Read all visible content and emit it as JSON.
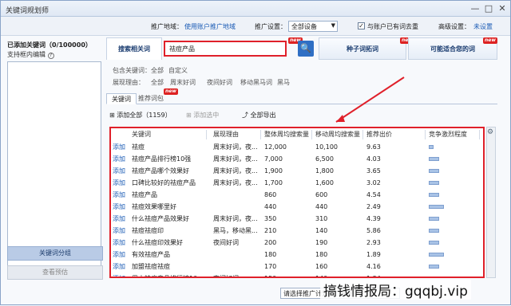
{
  "window": {
    "title": "关键词规划师",
    "min": "—",
    "max": "□",
    "close": "✕"
  },
  "topbar": {
    "area_label": "推广地域：",
    "area_value": "使用账户推广地域",
    "device_label": "推广设置：",
    "device_value": "全部设备",
    "dedupe_label": "与账户已有词去重",
    "dedupe_checked": true,
    "advanced_label": "高级设置：",
    "advanced_value": "未设置"
  },
  "left": {
    "added_title": "已添加关键词（0/100000）",
    "hint": "支持框内编辑",
    "help_icon": "?",
    "group_btn": "关键词分组",
    "preview_btn": "查看预估"
  },
  "search": {
    "tab_label": "搜索相关词",
    "query": "祛痘产品",
    "new_badge": "new",
    "tab2": "种子词拓词",
    "tab3": "可能适合您的词"
  },
  "filters": {
    "include_label": "包含关键词：",
    "include_opts": [
      "全部",
      "自定义"
    ],
    "reason_label": "展现理由：",
    "reason_opts": [
      "全部",
      "周末好词",
      "夜间好词",
      "移动黑马词",
      "黑马"
    ]
  },
  "subtabs": {
    "kw": "关键词",
    "pkg": "推荐词包",
    "pkg_new": "new"
  },
  "toolbar": {
    "add_all": "添加全部（1159）",
    "add_sel": "添加选中",
    "export": "全部导出"
  },
  "grid": {
    "headers": [
      "关键词",
      "展现理由",
      "整体周均搜索量",
      "移动周均搜索量",
      "推荐出价",
      "竞争激烈程度"
    ],
    "add_label": "添加",
    "rows": [
      {
        "kw": "祛痘",
        "reason": "周末好词，夜...",
        "total": "12,000",
        "mobile": "10,100",
        "bid": "9.63",
        "comp": 0.1
      },
      {
        "kw": "祛痘产品排行榜10强",
        "reason": "周末好词，夜...",
        "total": "7,000",
        "mobile": "6,500",
        "bid": "4.03",
        "comp": 0.22
      },
      {
        "kw": "祛痘产品哪个效果好",
        "reason": "周末好词，夜...",
        "total": "1,900",
        "mobile": "1,800",
        "bid": "3.65",
        "comp": 0.22
      },
      {
        "kw": "口碑比较好的祛痘产品",
        "reason": "周末好词，夜...",
        "total": "1,700",
        "mobile": "1,600",
        "bid": "3.02",
        "comp": 0.22
      },
      {
        "kw": "祛痘产品",
        "reason": "",
        "total": "860",
        "mobile": "600",
        "bid": "4.54",
        "comp": 0.22
      },
      {
        "kw": "祛痘效果哪里好",
        "reason": "",
        "total": "440",
        "mobile": "440",
        "bid": "2.49",
        "comp": 0.32
      },
      {
        "kw": "什么祛痘产品效果好",
        "reason": "周末好词，夜...",
        "total": "350",
        "mobile": "310",
        "bid": "4.39",
        "comp": 0.22
      },
      {
        "kw": "祛痘祛痘印",
        "reason": "黑马，移动黑...",
        "total": "210",
        "mobile": "140",
        "bid": "5.86",
        "comp": 0.22
      },
      {
        "kw": "什么祛痘印效果好",
        "reason": "夜间好词",
        "total": "200",
        "mobile": "190",
        "bid": "2.93",
        "comp": 0.22
      },
      {
        "kw": "有效祛痘产品",
        "reason": "",
        "total": "180",
        "mobile": "180",
        "bid": "1.89",
        "comp": 0.32
      },
      {
        "kw": "加盟祛痘祛痘",
        "reason": "",
        "total": "170",
        "mobile": "160",
        "bid": "4.16",
        "comp": 0.22
      },
      {
        "kw": "男士祛痘产品排行榜10...",
        "reason": "夜间好词",
        "total": "150",
        "mobile": "140",
        "bid": "1.34",
        "comp": 0.22
      }
    ]
  },
  "footer": {
    "status": "请选择推广计划推广单元"
  },
  "watermark": "搞钱情报局：gqqbj.vip",
  "colors": {
    "highlight": "#e0202a",
    "link": "#1a5bb5"
  }
}
